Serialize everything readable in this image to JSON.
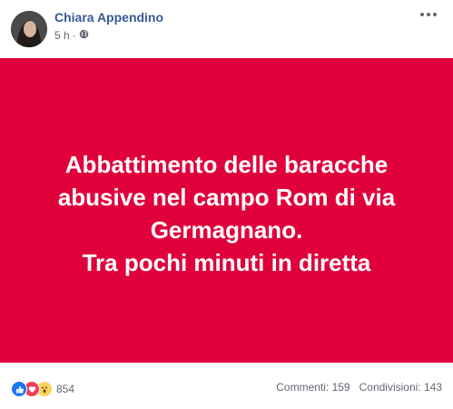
{
  "post": {
    "author": "Chiara Appendino",
    "time": "5 h",
    "separator": "·",
    "privacy_icon": "globe-icon",
    "banner_color": "#e0003c",
    "banner_lines": [
      "Abbattimento delle baracche",
      "abusive nel campo Rom di via",
      "Germagnano.",
      "Tra pochi minuti in diretta"
    ]
  },
  "footer": {
    "reaction_icons": [
      "like-icon",
      "love-icon",
      "wow-icon"
    ],
    "reaction_count": "854",
    "comments": "Commenti: 159",
    "shares": "Condivisioni: 143"
  },
  "colors": {
    "author": "#385898",
    "meta": "#616770",
    "like": "#1877f2",
    "love": "#f33e58",
    "wow": "#fcd359"
  }
}
